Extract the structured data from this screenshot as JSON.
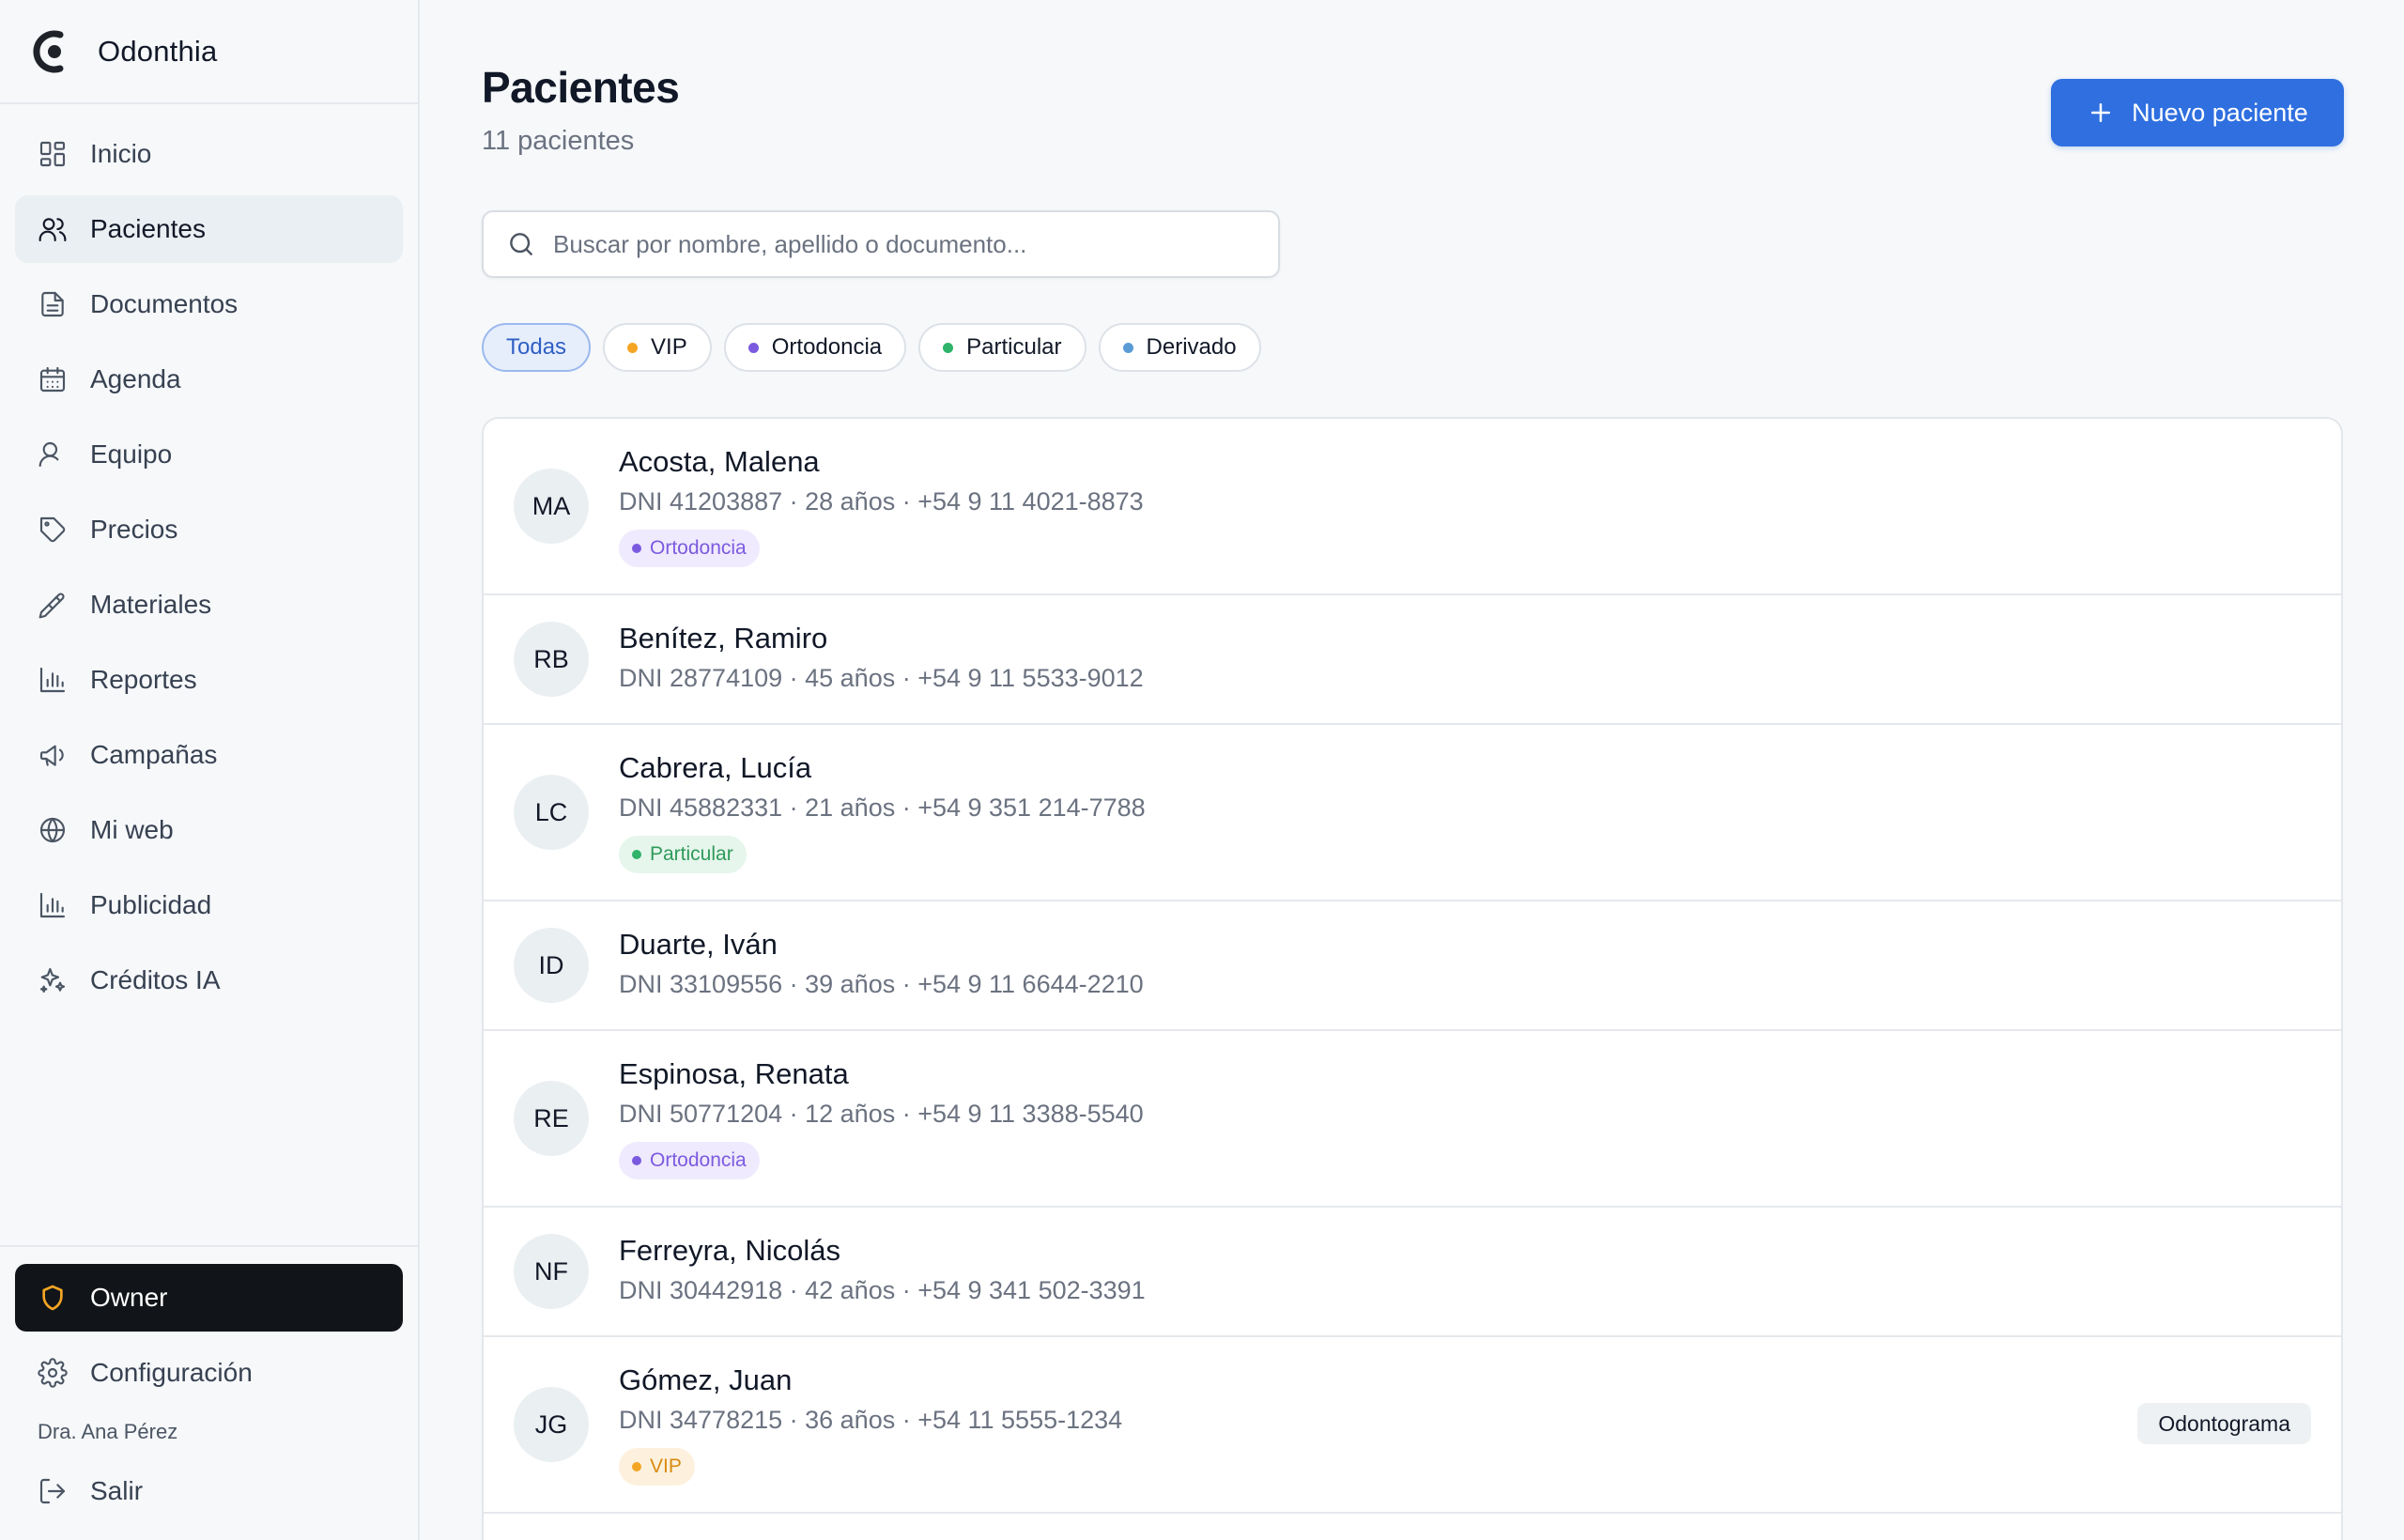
{
  "app": {
    "name": "Odonthia"
  },
  "sidebar": {
    "items": [
      {
        "label": "Inicio",
        "icon": "dashboard-icon",
        "active": false
      },
      {
        "label": "Pacientes",
        "icon": "users-icon",
        "active": true
      },
      {
        "label": "Documentos",
        "icon": "document-icon",
        "active": false
      },
      {
        "label": "Agenda",
        "icon": "calendar-icon",
        "active": false
      },
      {
        "label": "Equipo",
        "icon": "user-icon",
        "active": false
      },
      {
        "label": "Precios",
        "icon": "tag-icon",
        "active": false
      },
      {
        "label": "Materiales",
        "icon": "pipette-icon",
        "active": false
      },
      {
        "label": "Reportes",
        "icon": "bar-chart-icon",
        "active": false
      },
      {
        "label": "Campañas",
        "icon": "megaphone-icon",
        "active": false
      },
      {
        "label": "Mi web",
        "icon": "globe-icon",
        "active": false
      },
      {
        "label": "Publicidad",
        "icon": "bar-chart-icon",
        "active": false
      },
      {
        "label": "Créditos IA",
        "icon": "sparkles-icon",
        "active": false
      }
    ],
    "owner_label": "Owner",
    "config_label": "Configuración",
    "user_name": "Dra. Ana Pérez",
    "logout_label": "Salir"
  },
  "main": {
    "title": "Pacientes",
    "count": "11 pacientes",
    "new_button": "Nuevo paciente",
    "search_placeholder": "Buscar por nombre, apellido o documento...",
    "filters": [
      {
        "label": "Todas",
        "active": true,
        "color": ""
      },
      {
        "label": "VIP",
        "active": false,
        "color": "#f5a524"
      },
      {
        "label": "Ortodoncia",
        "active": false,
        "color": "#7c5ae0"
      },
      {
        "label": "Particular",
        "active": false,
        "color": "#2fb36a"
      },
      {
        "label": "Derivado",
        "active": false,
        "color": "#5b9bd5"
      }
    ],
    "patients": [
      {
        "initials": "MA",
        "name": "Acosta, Malena",
        "meta": "DNI 41203887 · 28 años · +54 9 11 4021-8873",
        "tag": "Ortodoncia",
        "tag_type": "orto"
      },
      {
        "initials": "RB",
        "name": "Benítez, Ramiro",
        "meta": "DNI 28774109 · 45 años · +54 9 11 5533-9012",
        "tag": "",
        "tag_type": ""
      },
      {
        "initials": "LC",
        "name": "Cabrera, Lucía",
        "meta": "DNI 45882331 · 21 años · +54 9 351 214-7788",
        "tag": "Particular",
        "tag_type": "part"
      },
      {
        "initials": "ID",
        "name": "Duarte, Iván",
        "meta": "DNI 33109556 · 39 años · +54 9 11 6644-2210",
        "tag": "",
        "tag_type": ""
      },
      {
        "initials": "RE",
        "name": "Espinosa, Renata",
        "meta": "DNI 50771204 · 12 años · +54 9 11 3388-5540",
        "tag": "Ortodoncia",
        "tag_type": "orto"
      },
      {
        "initials": "NF",
        "name": "Ferreyra, Nicolás",
        "meta": "DNI 30442918 · 42 años · +54 9 341 502-3391",
        "tag": "",
        "tag_type": ""
      },
      {
        "initials": "JG",
        "name": "Gómez, Juan",
        "meta": "DNI 34778215 · 36 años · +54 11 5555-1234",
        "tag": "VIP",
        "tag_type": "vip",
        "action": "Odontograma"
      }
    ]
  }
}
